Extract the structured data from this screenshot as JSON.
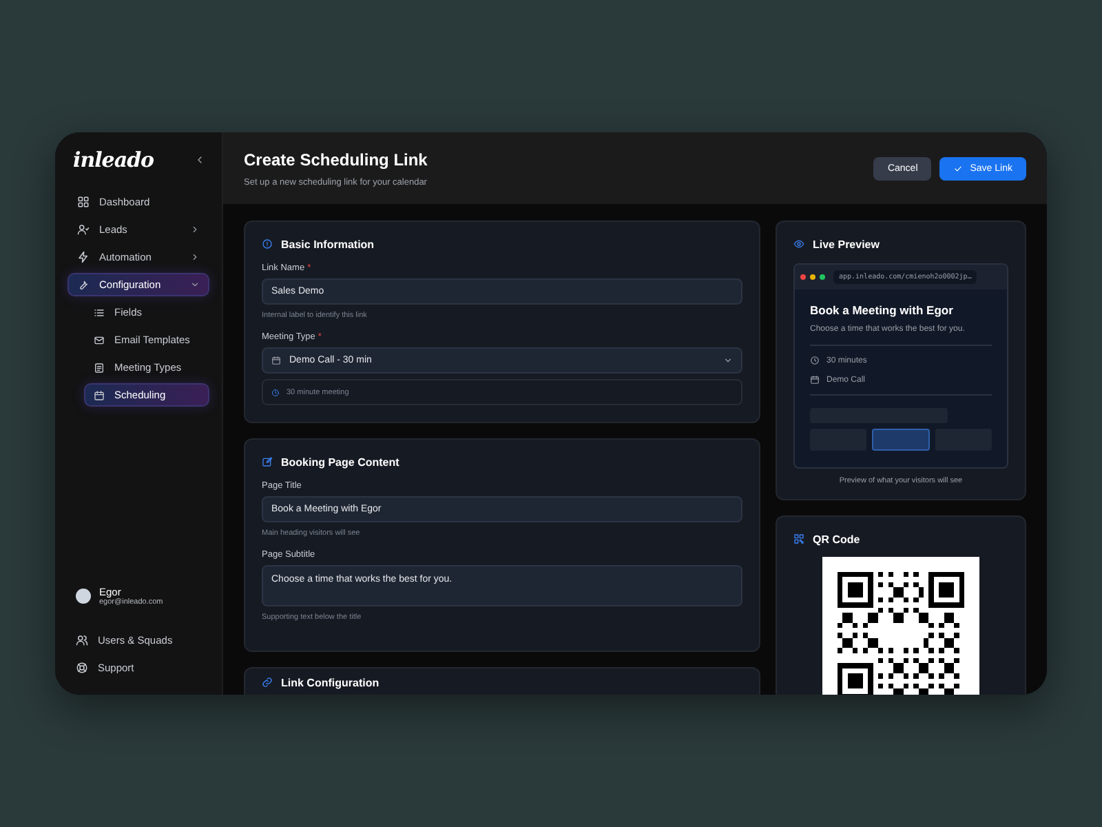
{
  "sidebar": {
    "logo": "inleado",
    "items": [
      {
        "label": "Dashboard",
        "selected": false
      },
      {
        "label": "Leads",
        "selected": false,
        "expanded": false
      },
      {
        "label": "Automation",
        "selected": false,
        "expanded": false
      },
      {
        "label": "Configuration",
        "selected": true,
        "expanded": true,
        "children": [
          {
            "label": "Fields",
            "selected": false
          },
          {
            "label": "Email Templates",
            "selected": false
          },
          {
            "label": "Meeting Types",
            "selected": false
          },
          {
            "label": "Scheduling",
            "selected": true
          }
        ]
      }
    ],
    "user": {
      "name": "Egor",
      "email": "egor@inleado.com"
    },
    "footer_items": [
      {
        "label": "Users & Squads"
      },
      {
        "label": "Support"
      }
    ]
  },
  "header": {
    "title": "Create Scheduling Link",
    "subtitle": "Set up a new scheduling link for your calendar",
    "buttons": [
      {
        "label": "Cancel",
        "kind": "secondary"
      },
      {
        "label": "Save Link",
        "kind": "primary"
      }
    ]
  },
  "cards": [
    {
      "title": "Basic Information",
      "fields": [
        {
          "kind": "input",
          "label": "Link Name",
          "required_mark": "*",
          "value": "Sales Demo",
          "hint": "Internal label to identify this link"
        },
        {
          "kind": "select",
          "label": "Meeting Type",
          "required_mark": "*",
          "value": "Demo Call - 30 min",
          "note": "30 minute meeting"
        }
      ]
    },
    {
      "title": "Booking Page Content",
      "fields": [
        {
          "kind": "input",
          "label": "Page Title",
          "value": "Book a Meeting with Egor",
          "hint": "Main heading visitors will see"
        },
        {
          "kind": "textarea",
          "label": "Page Subtitle",
          "value": "Choose a time that works the best for you.",
          "hint": "Supporting text below the title"
        }
      ]
    },
    {
      "title": "Link Configuration"
    }
  ],
  "preview": {
    "title": "Live Preview",
    "url": "app.inleado.com/cmienoh2o0002jp…",
    "page_title": "Book a Meeting with Egor",
    "page_subtitle": "Choose a time that works the best for you.",
    "duration": "30 minutes",
    "meeting": "Demo Call",
    "slots": [
      {
        "selected": false
      },
      {
        "selected": true
      },
      {
        "selected": false
      }
    ],
    "caption": "Preview of what your visitors will see"
  },
  "qr": {
    "title": "QR Code"
  }
}
